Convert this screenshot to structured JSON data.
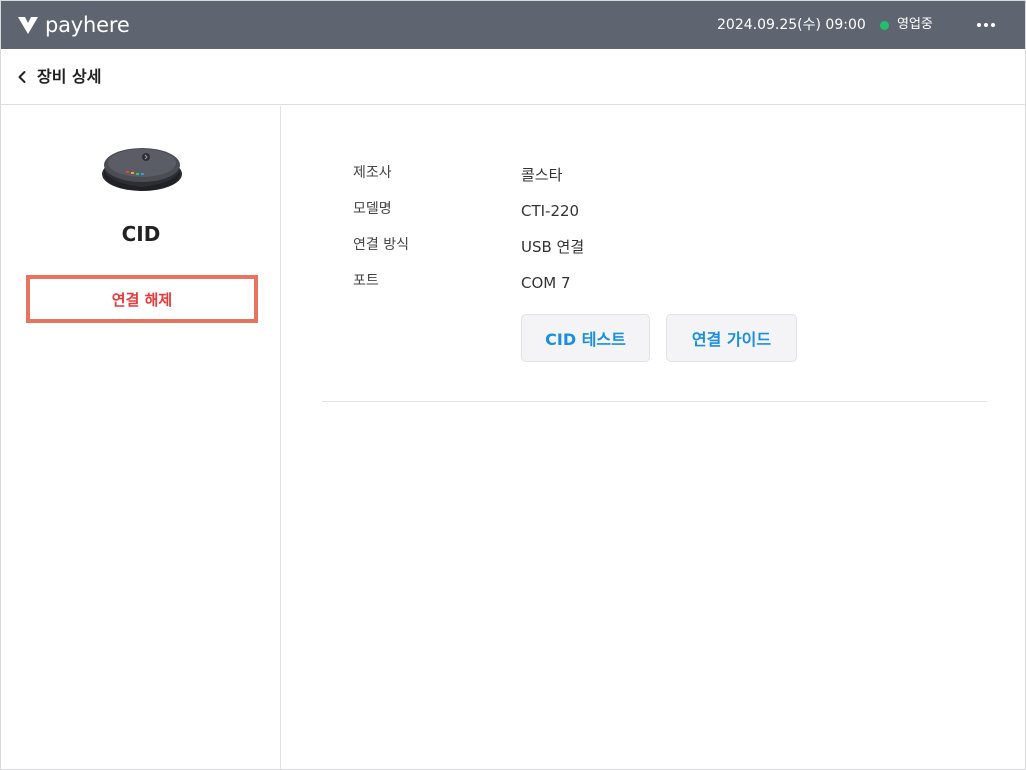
{
  "topbar": {
    "brand_name": "payhere",
    "datetime": "2024.09.25(수) 09:00",
    "status_label": "영업중",
    "status_color": "#1fbf6b",
    "more_icon": "more-horizontal-icon",
    "background_color": "#5e6470"
  },
  "header": {
    "back_icon": "chevron-left-icon",
    "title": "장비 상세"
  },
  "device": {
    "image_icon": "cid-device-icon",
    "name": "CID",
    "disconnect_label": "연결 해제",
    "disconnect_color": "#e53b3b"
  },
  "details": [
    {
      "label": "제조사",
      "value": "콜스타"
    },
    {
      "label": "모델명",
      "value": "CTI-220"
    },
    {
      "label": "연결 방식",
      "value": "USB 연결"
    },
    {
      "label": "포트",
      "value": "COM 7"
    }
  ],
  "actions": {
    "test_label": "CID 테스트",
    "guide_label": "연결 가이드",
    "accent_color": "#1a8fe0"
  }
}
